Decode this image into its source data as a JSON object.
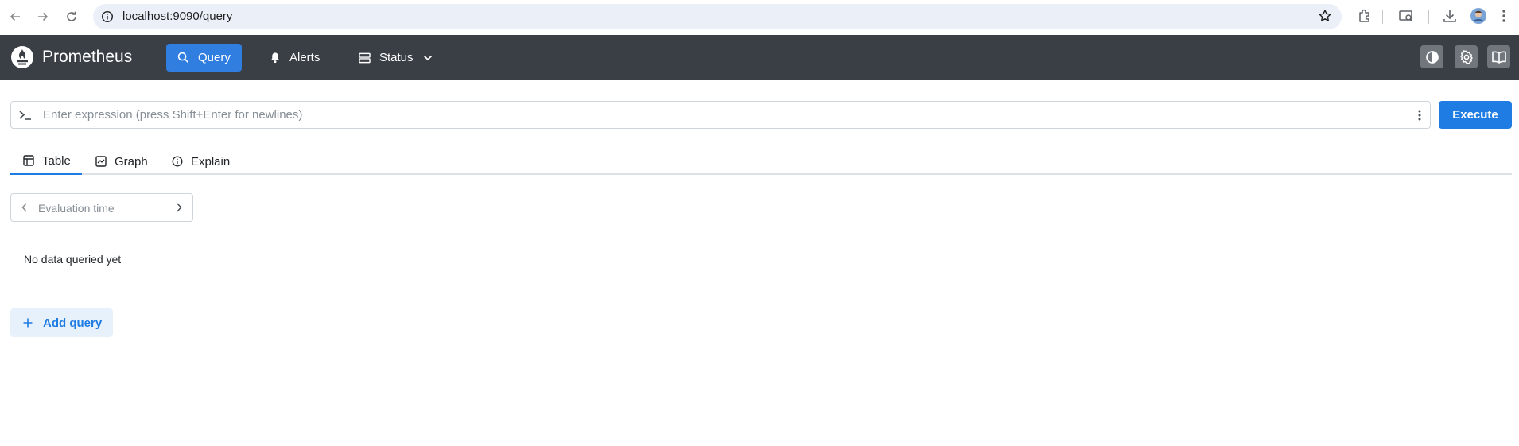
{
  "browser": {
    "url": "localhost:9090/query",
    "icons": [
      "back-icon",
      "forward-icon",
      "reload-icon",
      "site-info-icon",
      "bookmark-star-icon",
      "extensions-icon",
      "tab-search-icon",
      "download-icon",
      "profile-avatar",
      "chrome-menu-icon"
    ]
  },
  "header": {
    "brand": "Prometheus",
    "nav": {
      "query": "Query",
      "alerts": "Alerts",
      "status": "Status"
    },
    "buttons": [
      "theme-toggle-icon",
      "settings-gear-icon",
      "documentation-book-icon"
    ],
    "colors": {
      "background": "#3a3f46",
      "active": "#2f7ee0"
    }
  },
  "query": {
    "placeholder": "Enter expression (press Shift+Enter for newlines)",
    "value": "",
    "execute_label": "Execute"
  },
  "tabs": {
    "table": "Table",
    "graph": "Graph",
    "explain": "Explain",
    "active": "table"
  },
  "evaluation": {
    "placeholder": "Evaluation time"
  },
  "results": {
    "empty_message": "No data queried yet"
  },
  "actions": {
    "add_query": "Add query"
  },
  "colors": {
    "accent": "#1e7ce3",
    "accent_light": "#e7f1fc"
  }
}
